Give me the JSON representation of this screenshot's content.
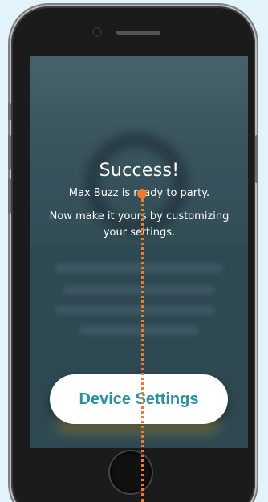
{
  "screen": {
    "title": "Success!",
    "subtitle": "Max Buzz is ready to party.",
    "body": "Now make it yours by customizing your settings."
  },
  "cta": {
    "label": "Device Settings"
  },
  "colors": {
    "background": "#e3f3fb",
    "cta_text": "#2e8fa1",
    "annotation": "#f07a2d",
    "overlay": "#334d57"
  },
  "icons": {
    "camera": "front-camera-icon",
    "home": "home-button-icon"
  }
}
